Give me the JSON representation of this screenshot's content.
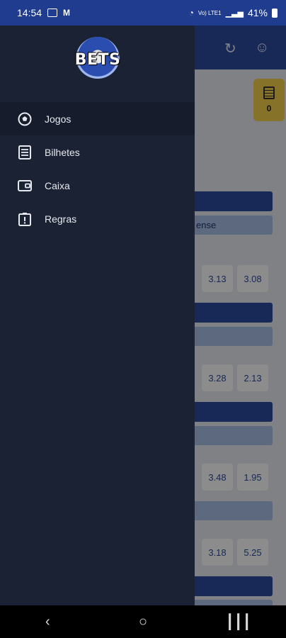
{
  "status_bar": {
    "time": "14:54",
    "battery": "41%",
    "signal": "Vo) LTE1"
  },
  "drawer": {
    "logo_text": "BETS",
    "menu": [
      {
        "label": "Jogos",
        "icon": "soccer-ball-icon",
        "active": true
      },
      {
        "label": "Bilhetes",
        "icon": "ticket-list-icon",
        "active": false
      },
      {
        "label": "Caixa",
        "icon": "wallet-icon",
        "active": false
      },
      {
        "label": "Regras",
        "icon": "rules-clipboard-icon",
        "active": false
      }
    ]
  },
  "background": {
    "ticket_count": "0",
    "team_partial": "ense",
    "odds": [
      [
        "3.13",
        "3.08"
      ],
      [
        "3.28",
        "2.13"
      ],
      [
        "3.48",
        "1.95"
      ],
      [
        "3.18",
        "5.25"
      ]
    ]
  },
  "colors": {
    "header": "#2c4c9f",
    "drawer": "#1b2233",
    "ticket": "#f4d04a"
  }
}
